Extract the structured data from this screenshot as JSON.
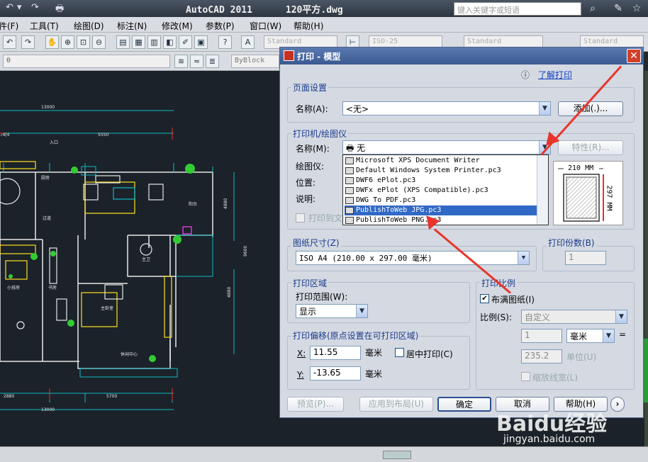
{
  "app": {
    "title": "AutoCAD 2011",
    "file": "120平方.dwg",
    "search_placeholder": "键入关键字或短语"
  },
  "menu": [
    "文件(F)",
    "工具(T)",
    "绘图(D)",
    "标注(N)",
    "修改(M)",
    "参数(P)",
    "窗口(W)",
    "帮助(H)"
  ],
  "toolbar": {
    "text_style": "Standard",
    "dim_style": "ISO-25",
    "table_style": "Standard",
    "ml_style": "Standard",
    "layer": "0",
    "color": "ByBlock"
  },
  "dialog": {
    "title": "打印 - 模型",
    "learn_link": "了解打印",
    "page_setup": {
      "label": "页面设置",
      "name_label": "名称(A):",
      "name_value": "<无>",
      "add_button": "添加(.)..."
    },
    "printer": {
      "label": "打印机/绘图仪",
      "name_label": "名称(M):",
      "name_value": "无",
      "properties_button": "特性(R)...",
      "plotter_label": "绘图仪:",
      "location_label": "位置:",
      "description_label": "说明:",
      "plot_to_file": "打印到文",
      "options": [
        "Microsoft XPS Document Writer",
        "Default Windows System Printer.pc3",
        "DWF6 ePlot.pc3",
        "DWFx ePlot (XPS Compatible).pc3",
        "DWG To PDF.pc3",
        "PublishToWeb JPG.pc3",
        "PublishToWeb PNG.pc3"
      ],
      "selected_index": 5,
      "paper_width": "210 MM",
      "paper_height": "297 MM"
    },
    "paper_size": {
      "label": "图纸尺寸(Z)",
      "value": "ISO A4 (210.00 x 297.00 毫米)"
    },
    "copies": {
      "label": "打印份数(B)",
      "value": "1"
    },
    "plot_area": {
      "label": "打印区域",
      "range_label": "打印范围(W):",
      "range_value": "显示"
    },
    "plot_offset": {
      "label": "打印偏移(原点设置在可打印区域)",
      "x_label": "X:",
      "x_value": "11.55",
      "y_label": "Y:",
      "y_value": "-13.65",
      "unit": "毫米",
      "center_label": "居中打印(C)"
    },
    "plot_scale": {
      "label": "打印比例",
      "fit_label": "布满图纸(I)",
      "fit_checked": true,
      "scale_label": "比例(S):",
      "scale_value": "自定义",
      "val1": "1",
      "unit1": "毫米",
      "val2": "235.2",
      "unit2": "单位(U)",
      "lineweight_label": "缩放线宽(L)"
    },
    "buttons": {
      "preview": "预览(P)...",
      "apply": "应用到布局(U)",
      "ok": "确定",
      "cancel": "取消",
      "help": "帮助(H)"
    }
  },
  "watermark": {
    "brand": "Baidu经验",
    "url": "jingyan.baidu.com"
  }
}
